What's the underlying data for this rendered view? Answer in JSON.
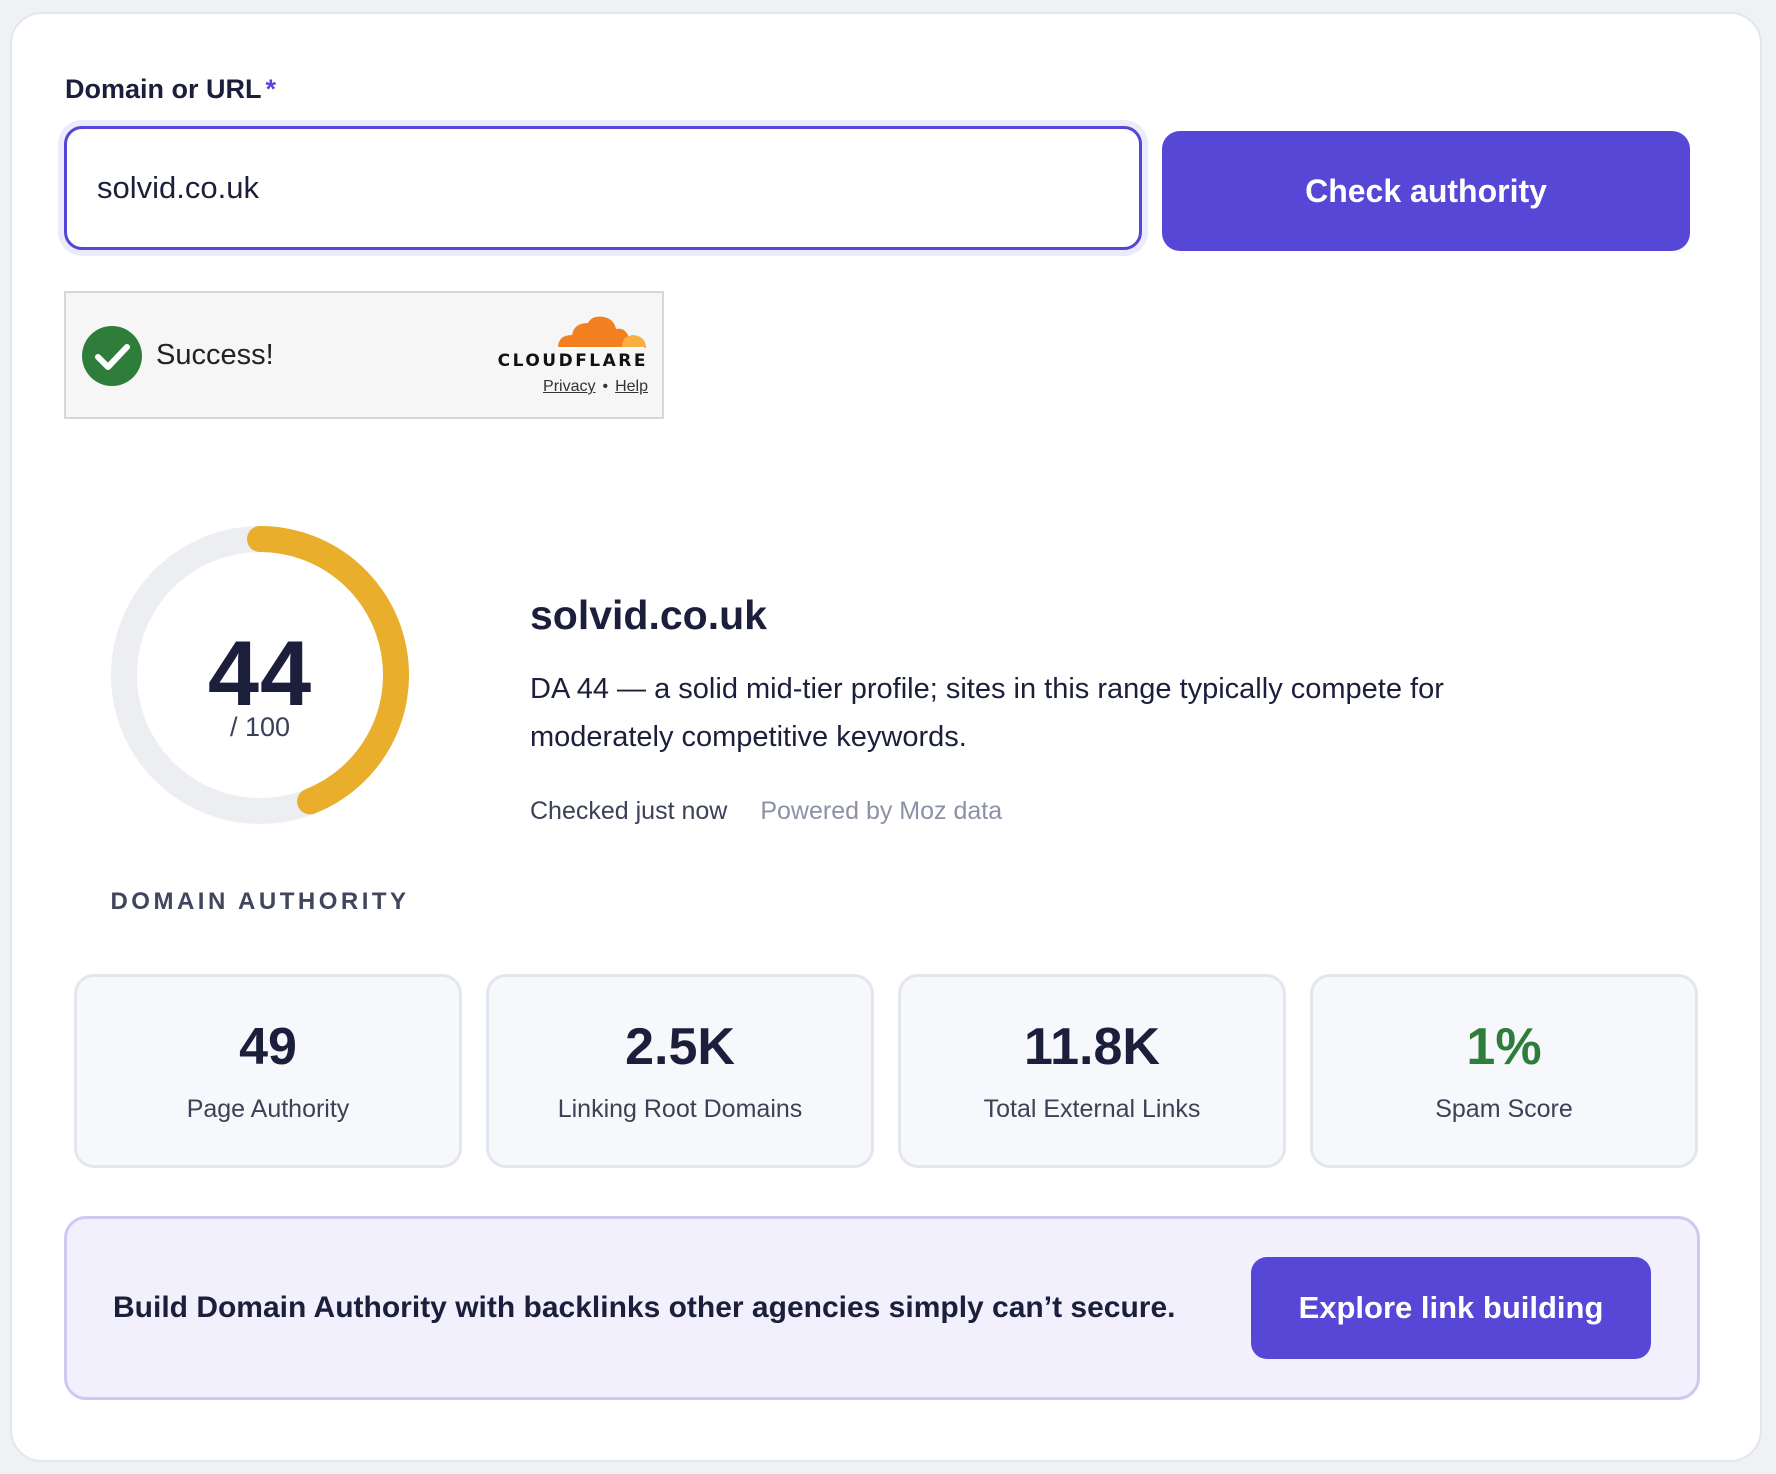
{
  "form": {
    "label": "Domain or URL",
    "required_mark": "*",
    "input_value": "solvid.co.uk",
    "submit_label": "Check authority"
  },
  "captcha": {
    "status": "Success!",
    "provider": "CLOUDFLARE",
    "privacy_label": "Privacy",
    "separator": "•",
    "help_label": "Help"
  },
  "gauge": {
    "value": "44",
    "max_label": "/ 100",
    "fraction": 0.44,
    "caption": "DOMAIN AUTHORITY",
    "color": "#e8ae2c",
    "track_color": "#eceef2"
  },
  "result": {
    "domain": "solvid.co.uk",
    "description": "DA 44 — a solid mid-tier profile; sites in this range typically compete for moderately competitive keywords.",
    "checked": "Checked just now",
    "powered": "Powered by Moz data"
  },
  "stats": [
    {
      "value": "49",
      "label": "Page Authority"
    },
    {
      "value": "2.5K",
      "label": "Linking Root Domains"
    },
    {
      "value": "11.8K",
      "label": "Total External Links"
    },
    {
      "value": "1%",
      "label": "Spam Score"
    }
  ],
  "cta": {
    "text": "Build Domain Authority with backlinks other agencies simply can’t secure.",
    "button_label": "Explore link building"
  },
  "colors": {
    "accent": "#5747d6",
    "success": "#2f7d3b",
    "cloudflare_orange": "#f38020"
  }
}
